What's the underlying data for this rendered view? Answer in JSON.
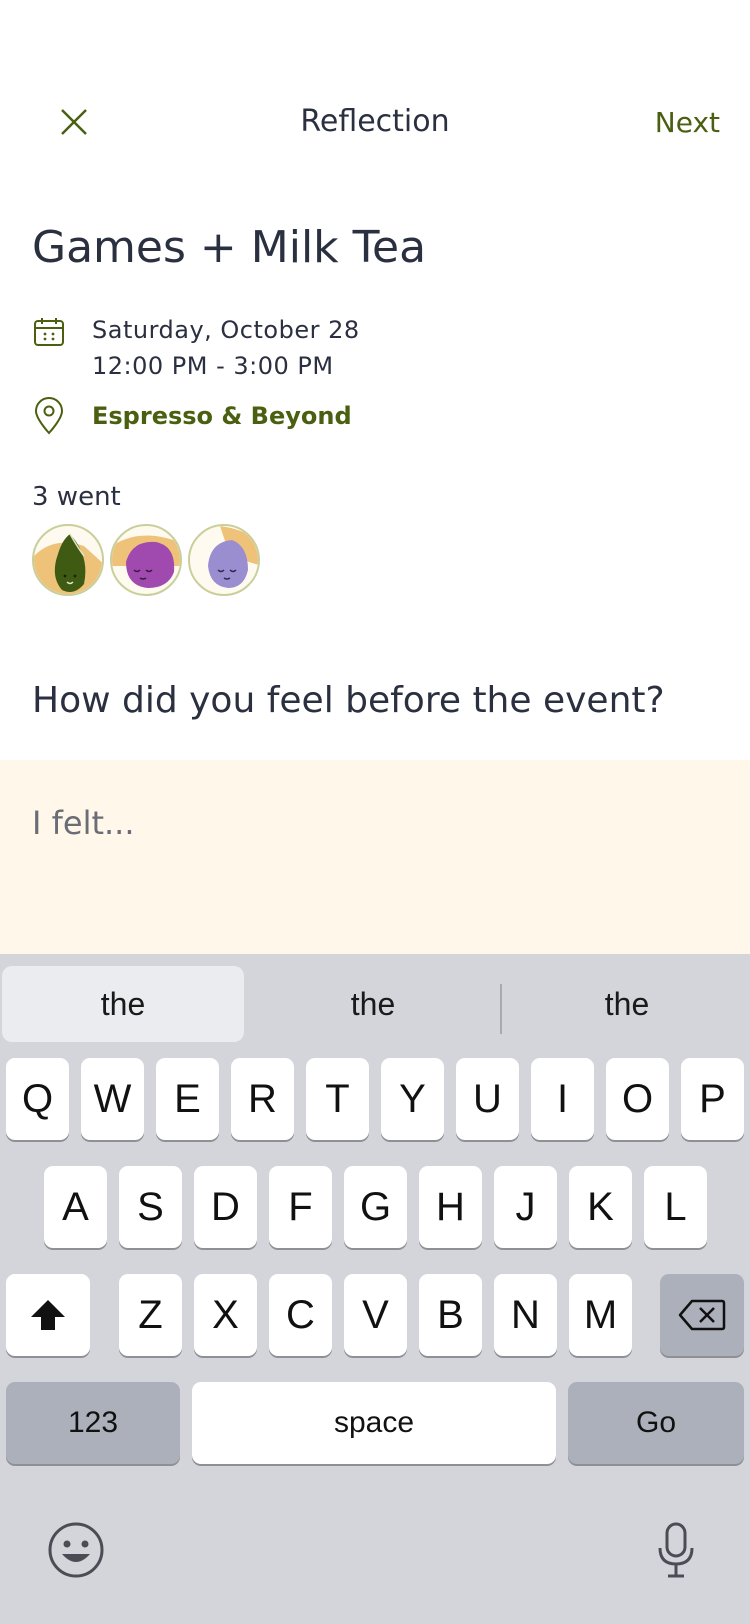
{
  "header": {
    "title": "Reflection",
    "next_label": "Next"
  },
  "event": {
    "title": "Games + Milk Tea",
    "date": "Saturday, October 28",
    "time": "12:00 PM - 3:00 PM",
    "location": "Espresso & Beyond",
    "attendance": "3 went",
    "avatars": [
      "green-character-avatar",
      "magenta-character-avatar",
      "lavender-character-avatar"
    ]
  },
  "question": {
    "text": "How did you feel before the event?",
    "placeholder": "I felt..."
  },
  "keyboard": {
    "suggestions": [
      "the",
      "the",
      "the"
    ],
    "row1": [
      "Q",
      "W",
      "E",
      "R",
      "T",
      "Y",
      "U",
      "I",
      "O",
      "P"
    ],
    "row2": [
      "A",
      "S",
      "D",
      "F",
      "G",
      "H",
      "J",
      "K",
      "L"
    ],
    "row3": [
      "Z",
      "X",
      "C",
      "V",
      "B",
      "N",
      "M"
    ],
    "numbers_label": "123",
    "space_label": "space",
    "go_label": "Go"
  },
  "colors": {
    "accent": "#4a6010",
    "text": "#2b3040",
    "answer_bg": "#fef7ea",
    "keyboard_bg": "#d3d5da"
  }
}
